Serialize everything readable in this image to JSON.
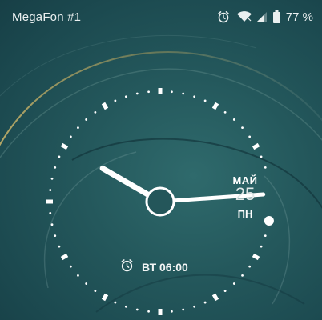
{
  "status_bar": {
    "carrier": "MegaFon #1",
    "battery_percent": "77 %",
    "icons": [
      "alarm-icon",
      "wifi-icon",
      "signal-icon",
      "battery-icon"
    ]
  },
  "clock": {
    "time": "10:15",
    "hour_hand_angle_deg": 300,
    "minute_hand_angle_deg": 86,
    "second_indicator_angle_deg": 100
  },
  "date": {
    "month": "МАЙ",
    "day": "25",
    "weekday": "ПН"
  },
  "next_alarm": {
    "icon": "alarm-icon",
    "label": "ВТ 06:00"
  },
  "colors": {
    "background": "#1f4d52",
    "foreground": "#ffffff"
  }
}
